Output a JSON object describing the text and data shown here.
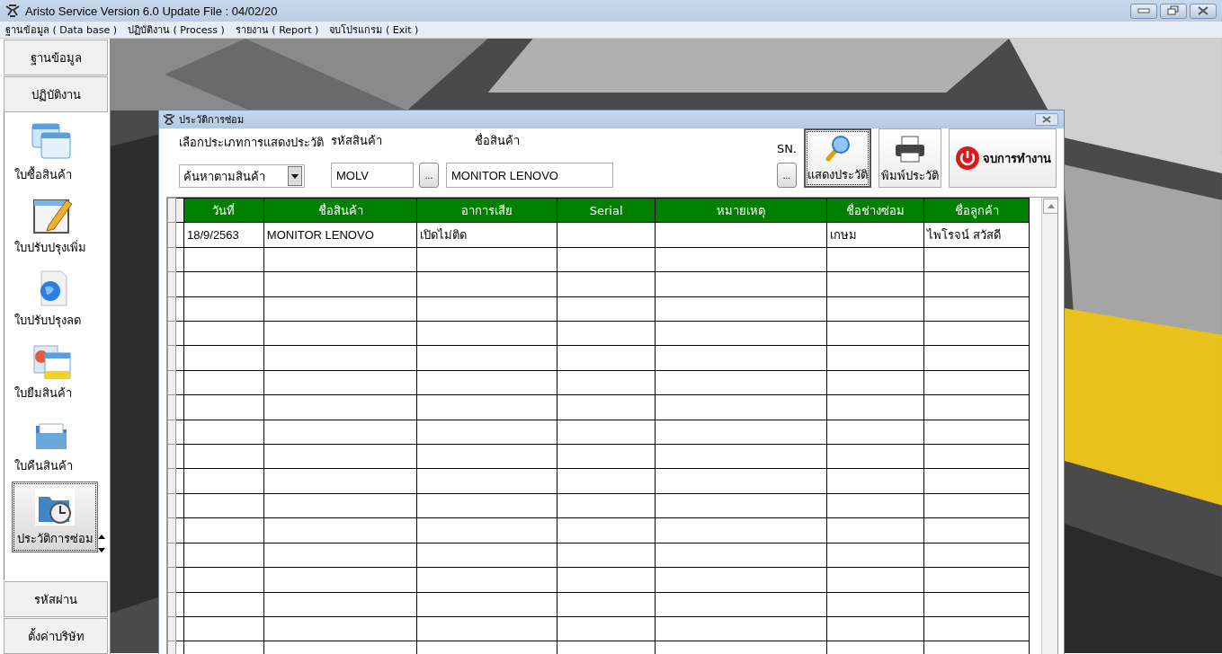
{
  "window": {
    "title": "Aristo Service Version 6.0 Update File : 04/02/20"
  },
  "menu": [
    "ฐานข้อมูล ( Data base )",
    "ปฏิบัติงาน ( Process )",
    "รายงาน ( Report )",
    "จบโปรแกรม ( Exit )"
  ],
  "sidebar": {
    "top_buttons": [
      "ฐานข้อมูล",
      "ปฏิบัติงาน"
    ],
    "items": [
      {
        "label": "ใบซื้อสินค้า",
        "selected": false
      },
      {
        "label": "ใบปรับปรุงเพิ่ม",
        "selected": false
      },
      {
        "label": "ใบปรับปรุงลด",
        "selected": false
      },
      {
        "label": "ใบยืมสินค้า",
        "selected": false
      },
      {
        "label": "ใบคืนสินค้า",
        "selected": false
      },
      {
        "label": "ประวัติการซ่อม",
        "selected": true
      }
    ],
    "bottom_buttons": [
      "รหัสผ่าน",
      "ตั้งค่าบริษัท"
    ]
  },
  "dialog": {
    "title": "ประวัติการซ่อม",
    "labels": {
      "type": "เลือกประเภทการแสดงประวัติ",
      "code": "รหัสสินค้า",
      "name": "ชื่อสินค้า",
      "sn": "SN."
    },
    "type_select": "ค้นหาตามสินค้า",
    "code_field": "MOLV",
    "browse": "...",
    "name_field": "MONITOR LENOVO",
    "sn_browse": "...",
    "buttons": [
      {
        "label": "แสดงประวัติ",
        "focused": true
      },
      {
        "label": "พิมพ์ประวัติ",
        "focused": false
      },
      {
        "label": "จบการทำงาน",
        "focused": false
      }
    ],
    "table": {
      "columns": [
        "วันที่",
        "ชื่อสินค้า",
        "อาการเสีย",
        "Serial",
        "หมายเหตุ",
        "ชื่อช่างซ่อม",
        "ชื่อลูกค้า"
      ],
      "rows": [
        [
          "18/9/2563",
          "MONITOR LENOVO",
          "เปิดไม่ติด",
          "",
          "",
          "เกษม",
          "ไพโรจน์ สวัสดี"
        ]
      ]
    }
  }
}
